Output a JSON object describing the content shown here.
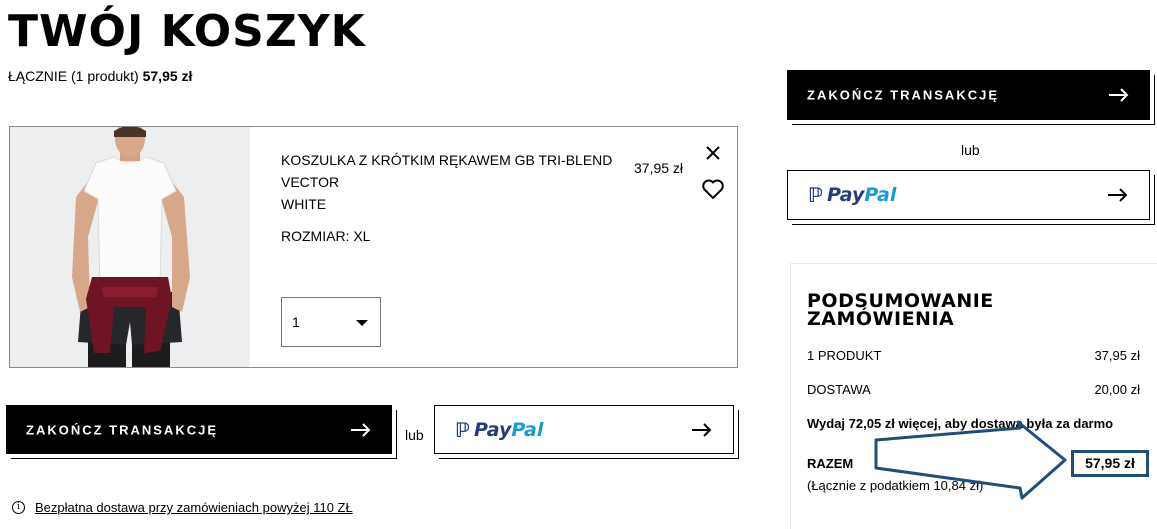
{
  "header": {
    "title": "TWÓJ KOSZYK",
    "total_prefix": "ŁĄCZNIE (1 produkt)",
    "total_value": "57,95 zł"
  },
  "cart": {
    "item": {
      "name": "KOSZULKA Z KRÓTKIM RĘKAWEM GB TRI-BLEND VECTOR",
      "color": "WHITE",
      "size": "ROZMIAR: XL",
      "price": "37,95 zł",
      "quantity": "1"
    }
  },
  "actions": {
    "checkout_label": "ZAKOŃCZ TRANSAKCJĘ",
    "or_label": "lub",
    "paypal_pay": "Pay",
    "paypal_pal": "Pal"
  },
  "summary": {
    "title_line1": "PODSUMOWANIE",
    "title_line2": "ZAMÓWIENIA",
    "products_label": "1 PRODUKT",
    "products_value": "37,95 zł",
    "delivery_label": "DOSTAWA",
    "delivery_value": "20,00 zł",
    "free_delivery_promo": "Wydaj 72,05 zł więcej, aby dostawa była za darmo",
    "total_label": "RAZEM",
    "total_value": "57,95 zł",
    "tax_note": "(Łącznie z podatkiem  10,84 zł)"
  },
  "footer": {
    "info_icon": "i",
    "free_shipping_link": "Bezpłatna dostawa przy zamówieniach powyżej 110 ZŁ"
  },
  "colors": {
    "primary": "#000000",
    "paypal_dark": "#253b80",
    "paypal_light": "#179bd7",
    "highlight": "#1f4e79"
  }
}
